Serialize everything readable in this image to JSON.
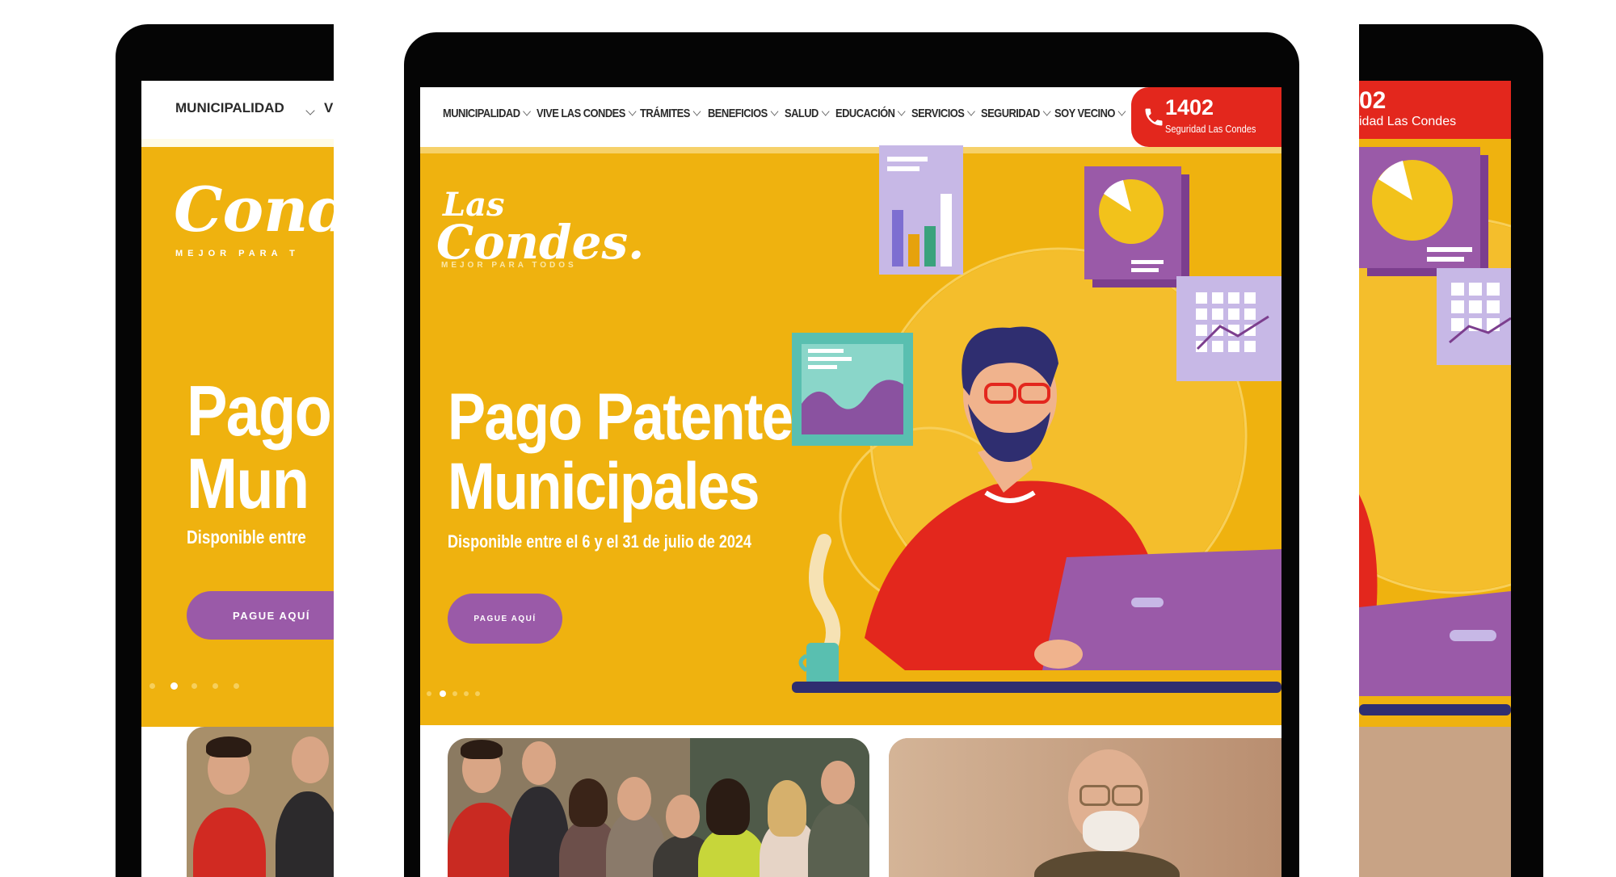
{
  "nav": {
    "items": [
      {
        "label": "MUNICIPALIDAD"
      },
      {
        "label": "VIVE LAS CONDES"
      },
      {
        "label": "TRÁMITES"
      },
      {
        "label": "BENEFICIOS"
      },
      {
        "label": "SALUD"
      },
      {
        "label": "EDUCACIÓN"
      },
      {
        "label": "SERVICIOS"
      },
      {
        "label": "SEGURIDAD"
      },
      {
        "label": "SOY VECINO"
      }
    ],
    "phone": {
      "number": "1402",
      "label": "Seguridad Las Condes",
      "number_cropped": "02",
      "label_cropped": "idad Las Condes"
    }
  },
  "left_device": {
    "nav_label": "MUNICIPALIDAD",
    "nav_next_letter": "V",
    "logo_cropped": "Cond",
    "tagline_cropped": "MEJOR PARA T",
    "title_line1_cropped": "Pago",
    "title_line2_cropped": "Mun",
    "subtitle_cropped": "Disponible entre",
    "cta_label": "PAGUE AQUÍ"
  },
  "logo": {
    "line1": "Las",
    "line2": "Condes.",
    "tagline": "MEJOR PARA TODOS"
  },
  "hero": {
    "title_line1": "Pago Patentes",
    "title_line2": "Municipales",
    "subtitle": "Disponible entre el 6 y el 31 de julio de 2024",
    "cta_label": "PAGUE AQUÍ",
    "slide_count": 5,
    "active_slide": 2
  },
  "colors": {
    "yellow": "#efb20f",
    "purple": "#9a5aa8",
    "red": "#e3271d",
    "bezel": "#050505"
  },
  "icons": {
    "phone": "phone-icon",
    "chevron": "chevron-down-icon"
  }
}
